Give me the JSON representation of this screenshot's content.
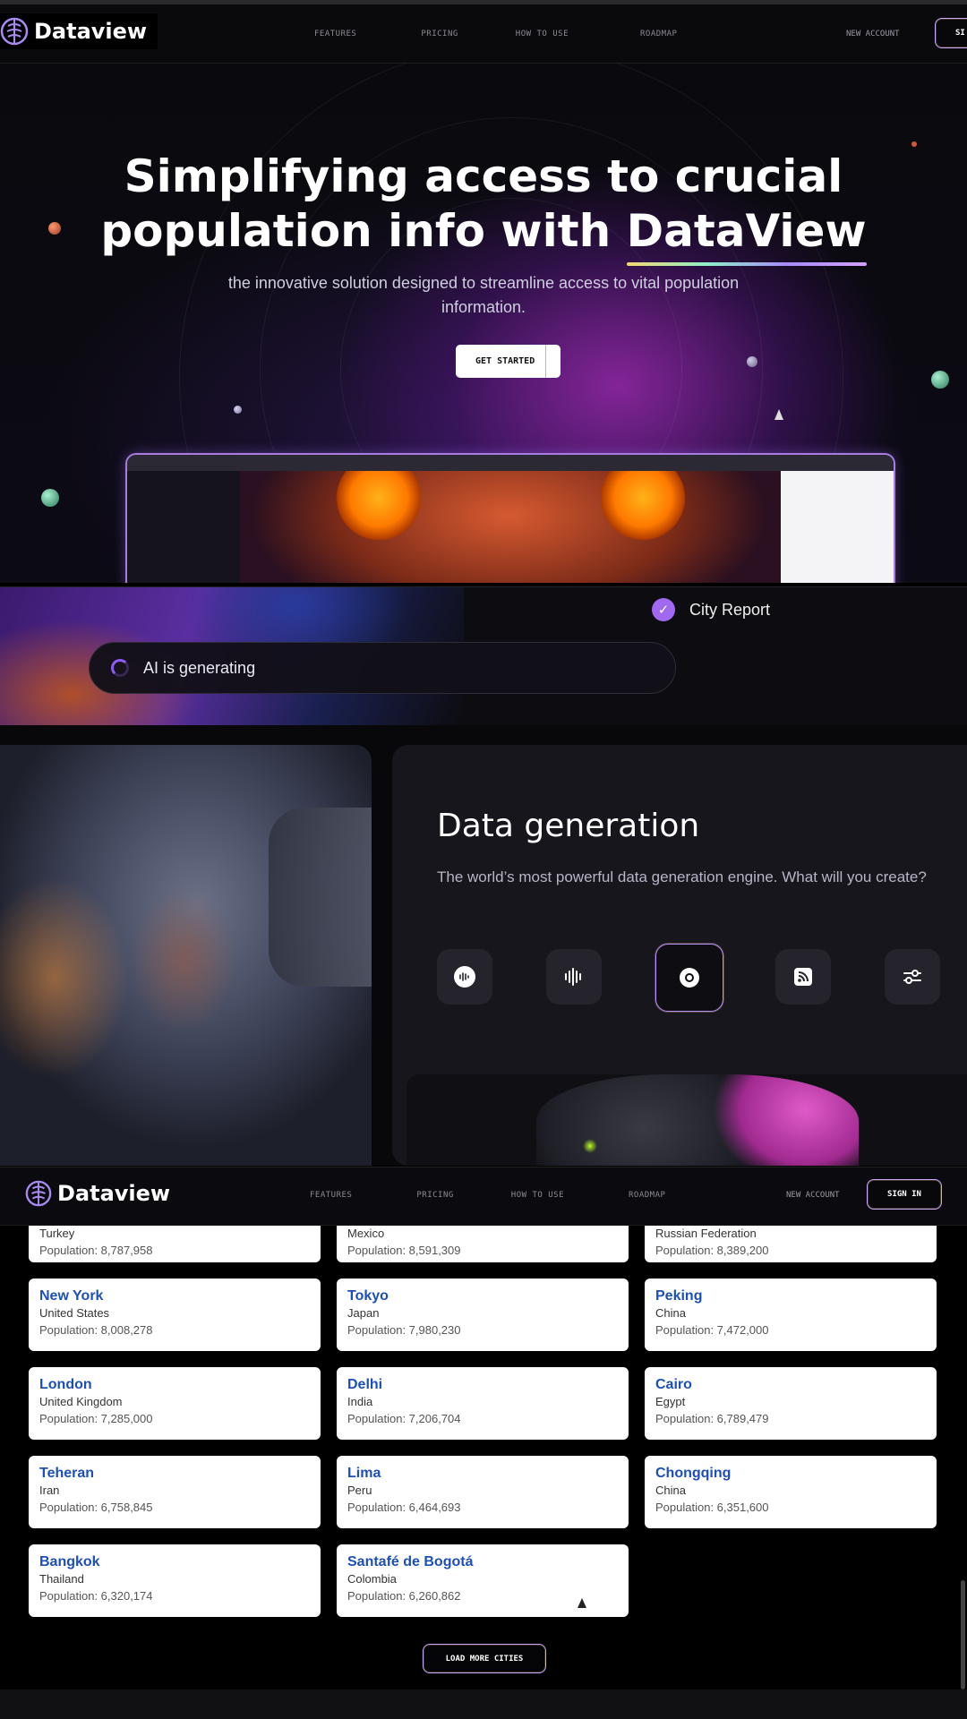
{
  "nav": {
    "brand": "Dataview",
    "links": [
      "FEATURES",
      "PRICING",
      "HOW TO USE",
      "ROADMAP"
    ],
    "new_account": "NEW ACCOUNT",
    "sign_in": "SIGN IN",
    "sign_in_partial": "SI"
  },
  "hero": {
    "title_line1": "Simplifying access to crucial",
    "title_line2_prefix": "population  info with ",
    "title_highlight": "DataView",
    "subtitle": "the innovative solution designed to streamline access to vital population information.",
    "cta": "GET STARTED"
  },
  "ai_band": {
    "status": "AI is generating",
    "report_label": "City Report"
  },
  "data_generation": {
    "title": "Data generation",
    "description": "The world’s most powerful data generation engine. What will you create?",
    "icons": [
      "audio-waveform-icon",
      "soundwave-icon",
      "target-circle-icon",
      "rss-feed-icon",
      "sliders-icon"
    ],
    "active_icon_index": 2
  },
  "cities": {
    "partial_row": [
      {
        "country": "Turkey",
        "population": "Population: 8,787,958"
      },
      {
        "country": "Mexico",
        "population": "Population: 8,591,309"
      },
      {
        "country": "Russian Federation",
        "population": "Population: 8,389,200"
      }
    ],
    "cards": [
      {
        "name": "New York",
        "country": "United States",
        "population": "Population: 8,008,278"
      },
      {
        "name": "Tokyo",
        "country": "Japan",
        "population": "Population: 7,980,230"
      },
      {
        "name": "Peking",
        "country": "China",
        "population": "Population: 7,472,000"
      },
      {
        "name": "London",
        "country": "United Kingdom",
        "population": "Population: 7,285,000"
      },
      {
        "name": "Delhi",
        "country": "India",
        "population": "Population: 7,206,704"
      },
      {
        "name": "Cairo",
        "country": "Egypt",
        "population": "Population: 6,789,479"
      },
      {
        "name": "Teheran",
        "country": "Iran",
        "population": "Population: 6,758,845"
      },
      {
        "name": "Lima",
        "country": "Peru",
        "population": "Population: 6,464,693"
      },
      {
        "name": "Chongqing",
        "country": "China",
        "population": "Population: 6,351,600"
      },
      {
        "name": "Bangkok",
        "country": "Thailand",
        "population": "Population: 6,320,174"
      },
      {
        "name": "Santafé de Bogotá",
        "country": "Colombia",
        "population": "Population: 6,260,862"
      }
    ],
    "load_more": "LOAD MORE CITIES"
  },
  "colors": {
    "accent_purple": "#a168f0",
    "city_link_blue": "#1d4fb8",
    "border_gradient": "#c9a8ff"
  }
}
